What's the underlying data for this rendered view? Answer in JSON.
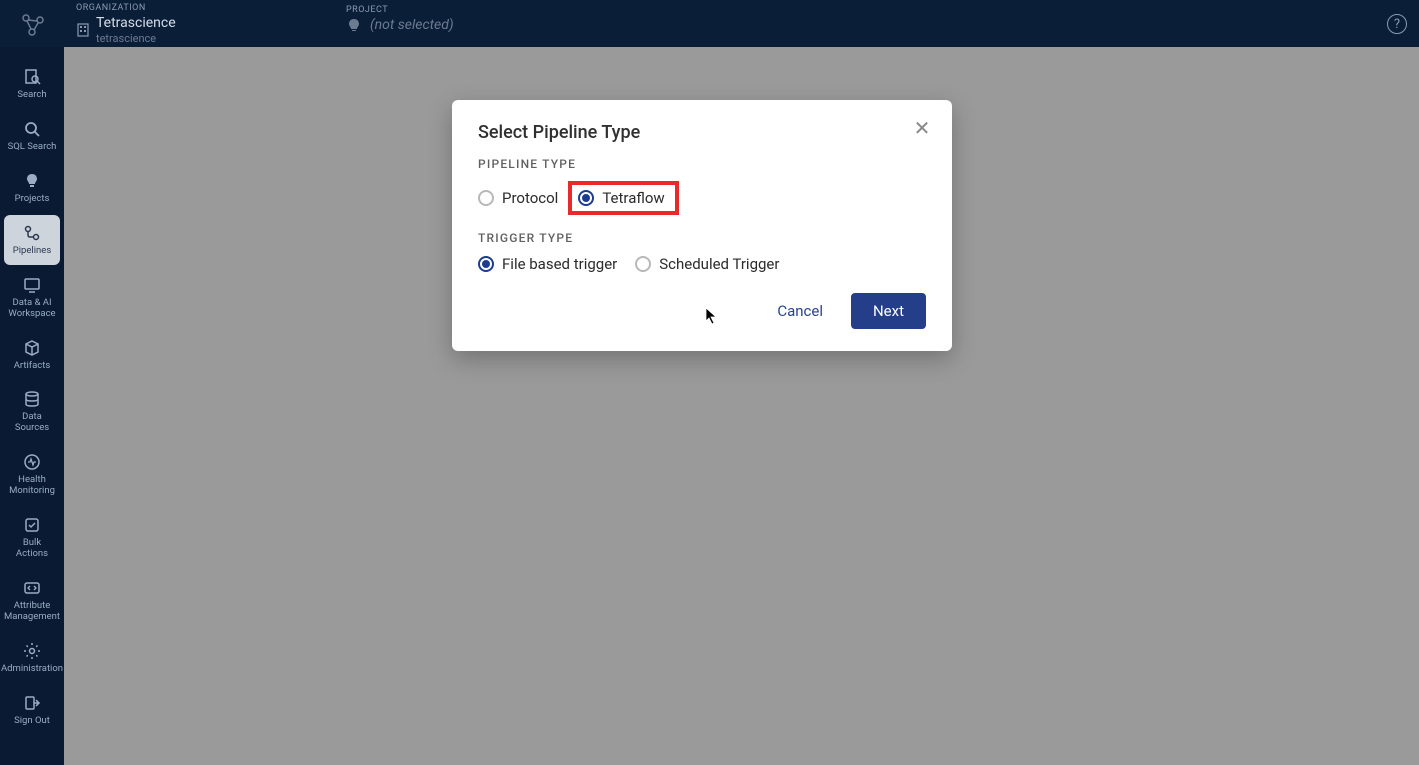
{
  "header": {
    "org_label": "ORGANIZATION",
    "org_name": "Tetrascience",
    "org_sub": "tetrascience",
    "project_label": "PROJECT",
    "project_value": "(not selected)"
  },
  "sidebar": {
    "items": [
      {
        "label": "Search",
        "icon": "search-doc-icon"
      },
      {
        "label": "SQL Search",
        "icon": "sql-search-icon"
      },
      {
        "label": "Projects",
        "icon": "lightbulb-icon"
      },
      {
        "label": "Pipelines",
        "icon": "pipeline-icon",
        "active": true
      },
      {
        "label": "Data & AI Workspace",
        "icon": "monitor-icon"
      },
      {
        "label": "Artifacts",
        "icon": "cube-icon"
      },
      {
        "label": "Data Sources",
        "icon": "stack-icon"
      },
      {
        "label": "Health Monitoring",
        "icon": "heart-pulse-icon"
      },
      {
        "label": "Bulk Actions",
        "icon": "checklist-icon"
      },
      {
        "label": "Attribute Management",
        "icon": "code-icon"
      },
      {
        "label": "Administration",
        "icon": "gear-icon"
      },
      {
        "label": "Sign Out",
        "icon": "signout-icon"
      }
    ]
  },
  "modal": {
    "title": "Select Pipeline Type",
    "pipeline_type_label": "PIPELINE TYPE",
    "pipeline_options": {
      "protocol": "Protocol",
      "tetraflow": "Tetraflow"
    },
    "trigger_type_label": "TRIGGER TYPE",
    "trigger_options": {
      "file_based": "File based trigger",
      "scheduled": "Scheduled Trigger"
    },
    "cancel_label": "Cancel",
    "next_label": "Next"
  }
}
